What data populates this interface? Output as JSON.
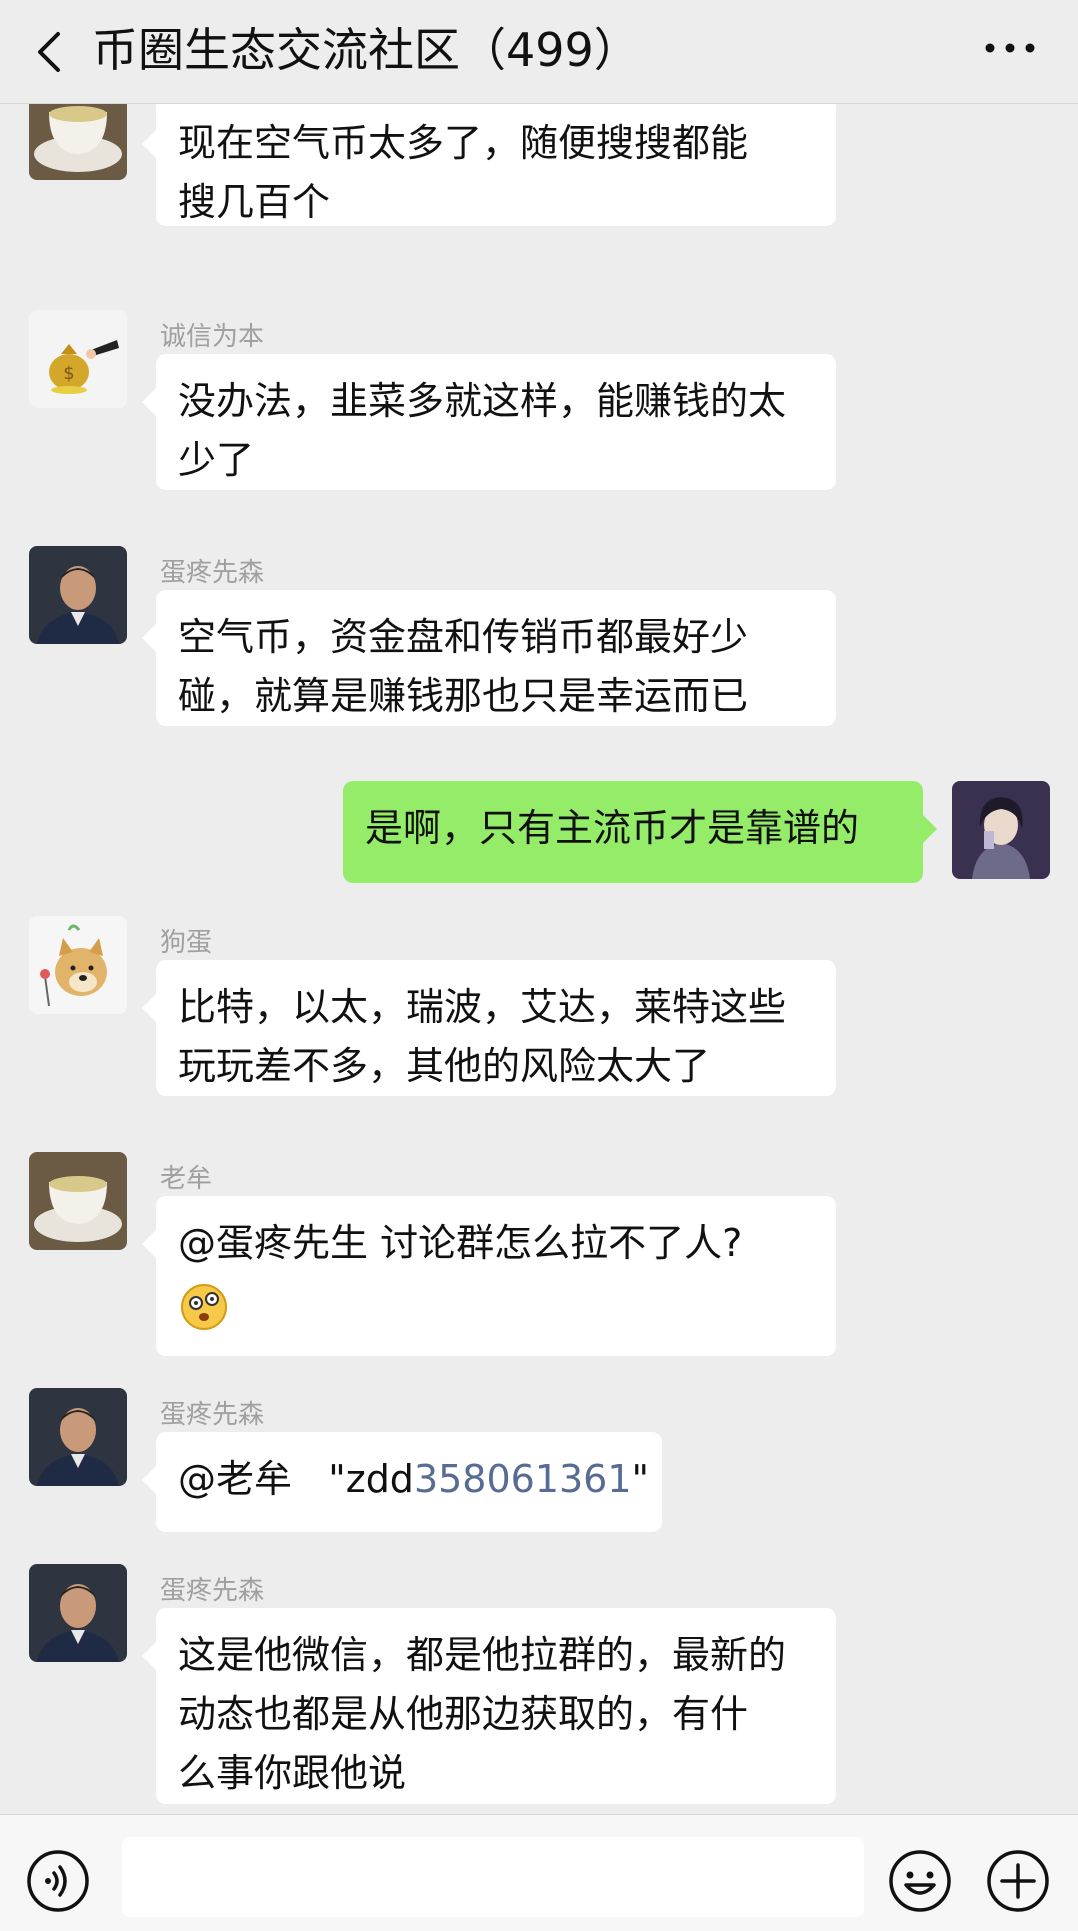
{
  "header": {
    "back_icon": "chevron-left-icon",
    "title": "币圈生态交流社区（499）",
    "more_icon": "more-dots-icon"
  },
  "messages": [
    {
      "sender": "",
      "side": "left",
      "avatar": "teacup",
      "lines": [
        "现在空气币太多了，随便搜搜都能",
        "搜几百个"
      ]
    },
    {
      "sender": "诚信为本",
      "side": "left",
      "avatar": "money-bag",
      "lines": [
        "没办法，韭菜多就这样，能赚钱的太",
        "少了"
      ]
    },
    {
      "sender": "蛋疼先森",
      "side": "left",
      "avatar": "man-portrait",
      "lines": [
        "空气币，资金盘和传销币都最好少",
        "碰，就算是赚钱那也只是幸运而已"
      ]
    },
    {
      "sender": "",
      "side": "right",
      "avatar": "anime-character",
      "lines": [
        "是啊，只有主流币才是靠谱的"
      ]
    },
    {
      "sender": "狗蛋",
      "side": "left",
      "avatar": "doge",
      "lines": [
        "比特，以太，瑞波，艾达，莱特这些",
        "玩玩差不多，其他的风险太大了"
      ]
    },
    {
      "sender": "老牟",
      "side": "left",
      "avatar": "teacup",
      "lines": [
        "@蛋疼先生 讨论群怎么拉不了人?"
      ],
      "emoji": "dizzy-face-emoji"
    },
    {
      "sender": "蛋疼先森",
      "side": "left",
      "avatar": "man-portrait",
      "mention": "@老牟",
      "id_prefix": "\"zdd",
      "id_link": "358061361",
      "id_suffix": "\""
    },
    {
      "sender": "蛋疼先森",
      "side": "left",
      "avatar": "man-portrait",
      "lines": [
        "这是他微信，都是他拉群的，最新的",
        "动态也都是从他那边获取的，有什",
        "么事你跟他说"
      ]
    }
  ],
  "input_bar": {
    "voice_icon": "voice-icon",
    "input_value": "",
    "emoji_icon": "emoji-icon",
    "plus_icon": "plus-icon"
  },
  "colors": {
    "background": "#ededed",
    "bubble_self": "#95ec69",
    "bubble_other": "#ffffff",
    "link": "#576b95"
  }
}
